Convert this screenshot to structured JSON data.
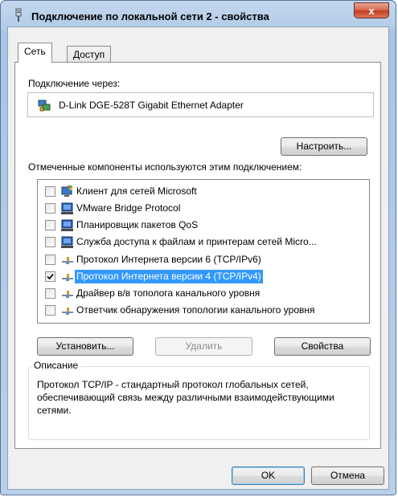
{
  "window": {
    "title": "Подключение по локальной сети 2 - свойства",
    "close_glyph": "x",
    "icon": "network-connection-icon"
  },
  "tabs": [
    {
      "label": "Сеть",
      "active": true
    },
    {
      "label": "Доступ",
      "active": false
    }
  ],
  "connect_using": {
    "label": "Подключение через:",
    "adapter_name": "D-Link DGE-528T Gigabit Ethernet Adapter",
    "configure_button": "Настроить..."
  },
  "components": {
    "label": "Отмеченные компоненты используются этим подключением:",
    "items": [
      {
        "label": "Клиент для сетей Microsoft",
        "checked": false,
        "icon": "network-client-icon"
      },
      {
        "label": "VMware Bridge Protocol",
        "checked": false,
        "icon": "service-icon"
      },
      {
        "label": "Планировщик пакетов QoS",
        "checked": false,
        "icon": "service-icon"
      },
      {
        "label": "Служба доступа к файлам и принтерам сетей Micro...",
        "checked": false,
        "icon": "service-icon"
      },
      {
        "label": "Протокол Интернета версии 6 (TCP/IPv6)",
        "checked": false,
        "icon": "protocol-icon"
      },
      {
        "label": "Протокол Интернета версии 4 (TCP/IPv4)",
        "checked": true,
        "selected": true,
        "icon": "protocol-icon"
      },
      {
        "label": "Драйвер в/в тополога канального уровня",
        "checked": false,
        "icon": "protocol-icon"
      },
      {
        "label": "Ответчик обнаружения топологии канального уровня",
        "checked": false,
        "icon": "protocol-icon"
      }
    ]
  },
  "actions": {
    "install": "Установить...",
    "uninstall": "Удалить",
    "properties": "Свойства"
  },
  "description": {
    "legend": "Описание",
    "text": "Протокол TCP/IP - стандартный протокол глобальных сетей, обеспечивающий связь между различными взаимодействующими сетями."
  },
  "footer": {
    "ok": "OK",
    "cancel": "Отмена"
  },
  "colors": {
    "selection": "#3399ff",
    "title_bar": "#b5cde8",
    "close_button": "#c23c22"
  }
}
